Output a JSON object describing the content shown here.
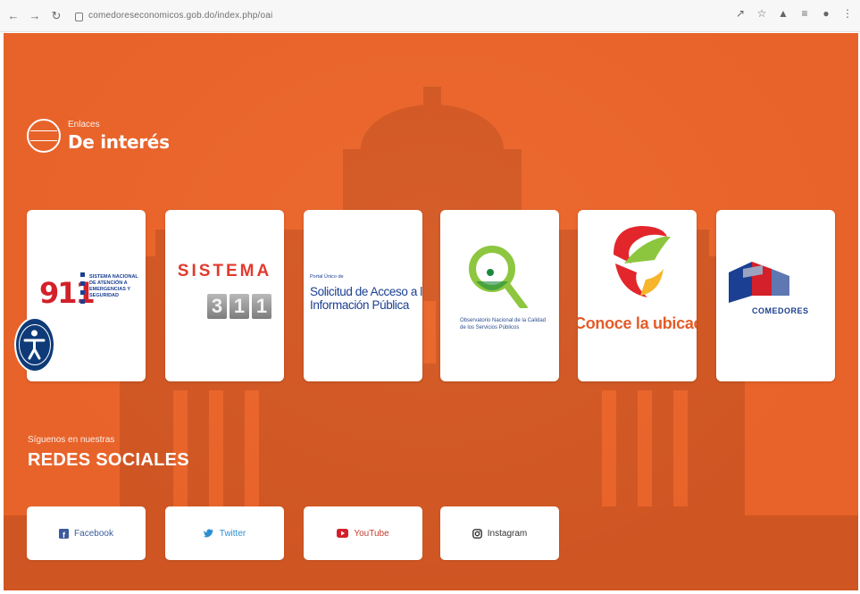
{
  "browser": {
    "url": "comedoreseconomicos.gob.do/index.php/oai"
  },
  "sections": {
    "links": {
      "subtitle": "Enlaces",
      "title": "De interés"
    },
    "social": {
      "subtitle": "Síguenos en nuestras",
      "title": "REDES SOCIALES"
    }
  },
  "link_cards": [
    {
      "number": "911",
      "text": "SISTEMA NACIONAL DE ATENCIÓN A EMERGENCIAS Y SEGURIDAD"
    },
    {
      "title": "SISTEMA",
      "digits": [
        "3",
        "1",
        "1"
      ]
    },
    {
      "small": "Portal Único de",
      "title": "Solicitud de Acceso a la Información Pública"
    },
    {
      "text": "Observatorio Nacional de la Calidad de los Servicios Públicos"
    },
    {
      "text": "Conoce la ubicación de nuestros comedores"
    },
    {
      "text": "COMEDORES"
    }
  ],
  "social_buttons": [
    "Facebook",
    "Twitter",
    "YouTube",
    "Instagram"
  ],
  "colors": {
    "page_bg": "#e8632a",
    "card_bg": "#ffffff",
    "accent_blue": "#1b3f92",
    "accent_red": "#d4202a"
  }
}
